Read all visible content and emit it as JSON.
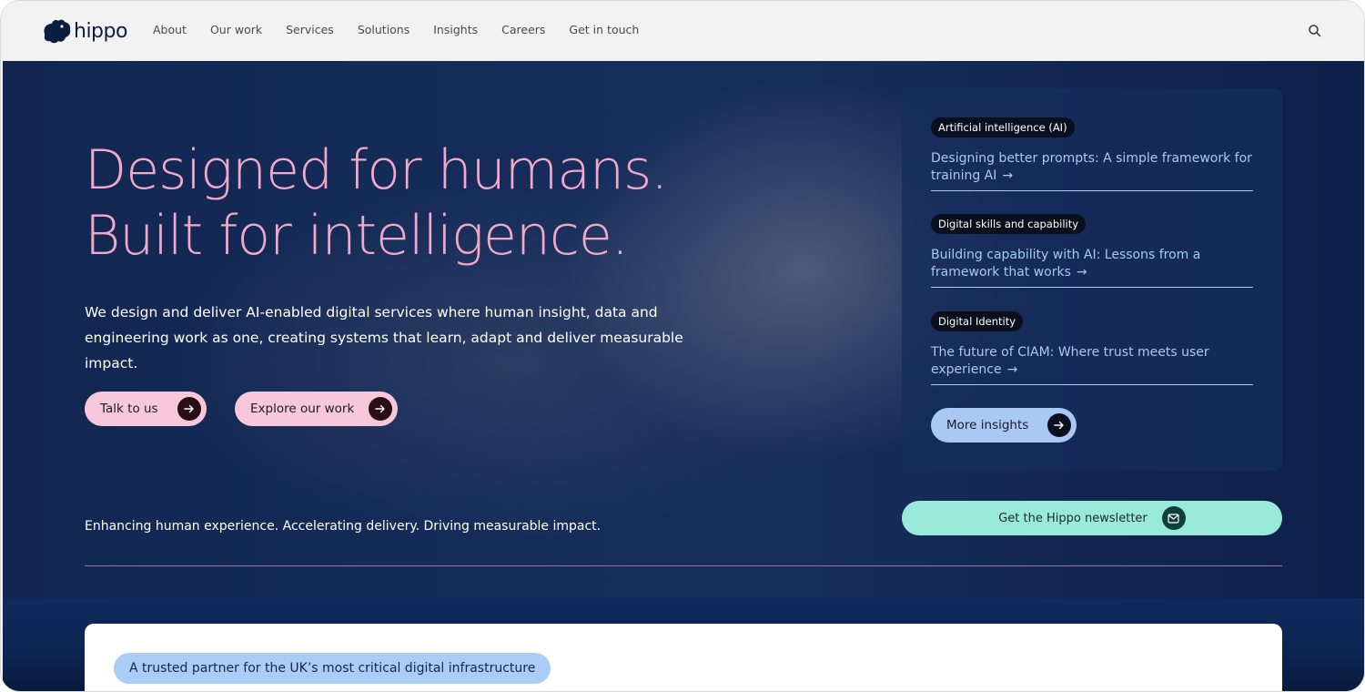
{
  "brand": {
    "name": "hippo",
    "color": "#0c1e40"
  },
  "nav": {
    "links": [
      "About",
      "Our work",
      "Services",
      "Solutions",
      "Insights",
      "Careers",
      "Get in touch"
    ],
    "search_icon": "search-icon"
  },
  "hero": {
    "headline_line1": "Designed for humans.",
    "headline_line2": "Built for intelligence.",
    "intro": "We design and deliver AI-enabled digital services where human insight, data and engineering work as one, creating systems that learn, adapt and deliver measurable impact.",
    "cta_primary": "Talk to us",
    "cta_secondary": "Explore our work",
    "tagline": "Enhancing human experience. Accelerating delivery. Driving measurable impact.",
    "accent_color": "#f2a9c9",
    "background_color": "#0f2a5c"
  },
  "insights": {
    "items": [
      {
        "tag": "Artificial intelligence (AI)",
        "title": "Designing better prompts: A simple framework for training AI"
      },
      {
        "tag": "Digital skills and capability",
        "title": "Building capability with AI: Lessons from a framework that works"
      },
      {
        "tag": "Digital Identity",
        "title": "The future of CIAM: Where trust meets user experience"
      }
    ],
    "more_label": "More insights"
  },
  "newsletter": {
    "label": "Get the Hippo newsletter",
    "color": "#9aeadc"
  },
  "trust": {
    "badge": "A trusted partner for the UK’s most critical digital infrastructure"
  },
  "arrow_glyph": "→"
}
